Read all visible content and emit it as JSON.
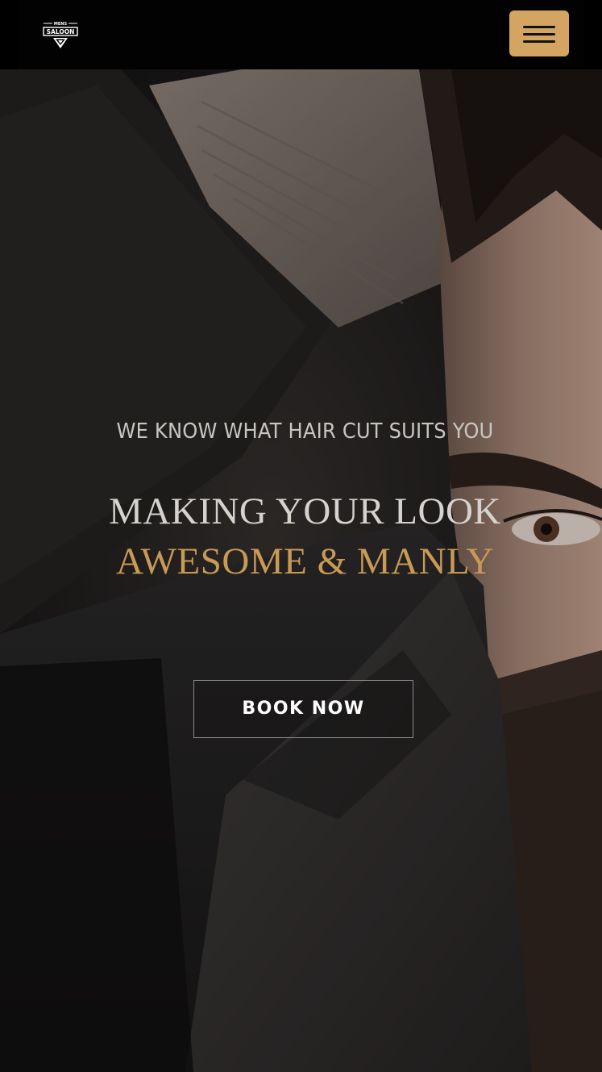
{
  "navbar": {
    "logo": {
      "top_text": "MENS",
      "main_text": "SALOON",
      "icon": "diamond-crest-icon"
    },
    "menu_button": {
      "icon": "hamburger-menu-icon",
      "color": "#d3a462"
    }
  },
  "hero": {
    "tagline": "WE KNOW WHAT HAIR CUT SUITS YOU",
    "title_line1": "MAKING YOUR LOOK",
    "title_line2": "AWESOME & MANLY",
    "accent_color": "#c99a55",
    "cta_label": "BOOK NOW",
    "background_image": "man-in-dark-jacket-photo"
  }
}
